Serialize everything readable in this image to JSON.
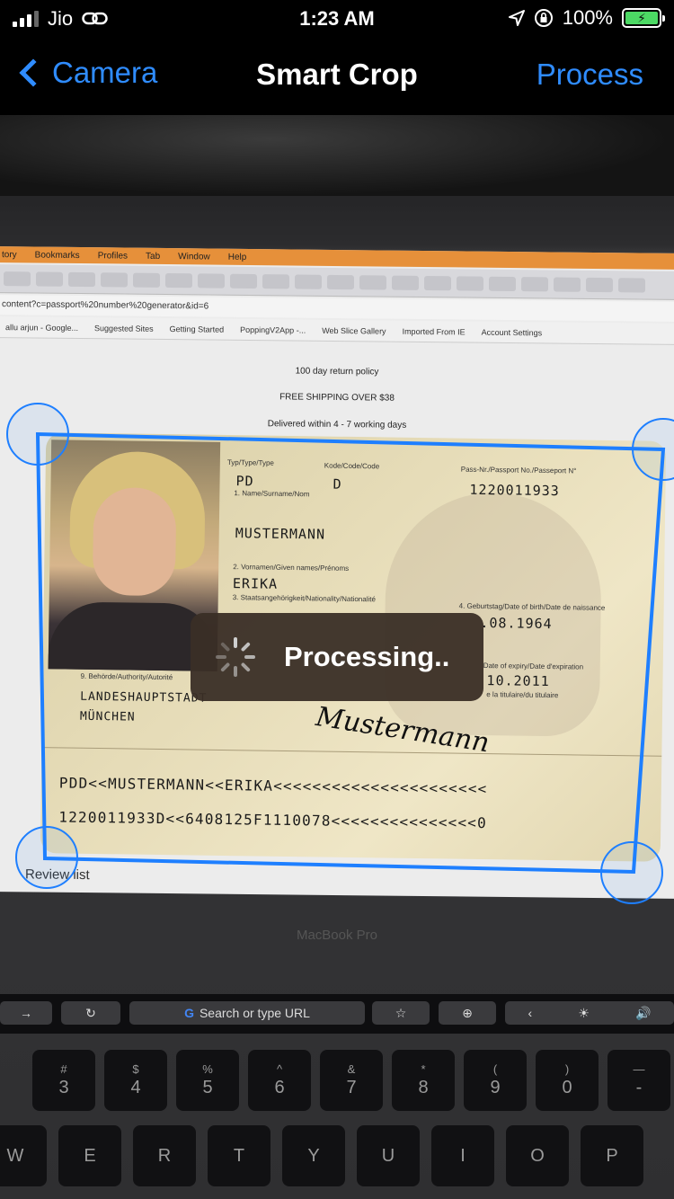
{
  "status_bar": {
    "carrier": "Jio",
    "time": "1:23 AM",
    "battery": "100%"
  },
  "nav": {
    "back_label": "Camera",
    "title": "Smart Crop",
    "action_label": "Process"
  },
  "browser": {
    "menu": [
      "tory",
      "Bookmarks",
      "Profiles",
      "Tab",
      "Window",
      "Help"
    ],
    "url": "content?c=passport%20number%20generator&id=6",
    "bookmarks": [
      "allu arjun - Google...",
      "Suggested Sites",
      "Getting Started",
      "PoppingV2App -...",
      "Web Slice Gallery",
      "Imported From IE",
      "Account Settings"
    ],
    "page_lines": [
      "100 day return policy",
      "FREE SHIPPING OVER $38",
      "Delivered within 4 - 7 working days"
    ],
    "review_label": "Review list"
  },
  "passport": {
    "type_label": "Typ/Type/Type",
    "type": "PD",
    "code_label": "Kode/Code/Code",
    "code": "D",
    "number_label": "Pass-Nr./Passport No./Passeport N°",
    "number": "1220011933",
    "surname_label": "1. Name/Surname/Nom",
    "surname": "MUSTERMANN",
    "given_label": "2. Vornamen/Given names/Prénoms",
    "given": "ERIKA",
    "nationality_label": "3. Staatsangehörigkeit/Nationality/Nationalité",
    "dob_label": "4. Geburtstag/Date of birth/Date de naissance",
    "dob": ".08.1964",
    "expiry_label": "Date of expiry/Date d'expiration",
    "expiry": "10.2011",
    "holder_label": "e la titulaire/du titulaire",
    "authority_label": "9. Behörde/Authority/Autorité",
    "authority_line1": "LANDESHAUPTSTADT",
    "authority_line2": "MÜNCHEN",
    "signature": "Mustermann",
    "mrz1": "PDD<<MUSTERMANN<<ERIKA<<<<<<<<<<<<<<<<<<<<<<",
    "mrz2": "1220011933D<<6408125F1110078<<<<<<<<<<<<<<<0"
  },
  "toast": {
    "text": "Processing.."
  },
  "laptop": {
    "brand": "MacBook Pro",
    "search_placeholder": "Search or type URL",
    "number_row": [
      {
        "top": "#",
        "main": "3"
      },
      {
        "top": "$",
        "main": "4"
      },
      {
        "top": "%",
        "main": "5"
      },
      {
        "top": "^",
        "main": "6"
      },
      {
        "top": "&",
        "main": "7"
      },
      {
        "top": "*",
        "main": "8"
      },
      {
        "top": "(",
        "main": "9"
      },
      {
        "top": ")",
        "main": "0"
      },
      {
        "top": "—",
        "main": "-"
      }
    ],
    "letter_row": [
      "W",
      "E",
      "R",
      "T",
      "Y",
      "U",
      "I",
      "O",
      "P"
    ]
  },
  "colors": {
    "accent": "#2f8cff",
    "crop_line": "#1e7fff",
    "battery_fill": "#4cd964",
    "toast_bg": "#3a2e26"
  },
  "icons": [
    "signal-icon",
    "link-icon",
    "location-icon",
    "rotation-lock-icon",
    "battery-icon",
    "back-chevron-icon",
    "spinner-icon"
  ]
}
